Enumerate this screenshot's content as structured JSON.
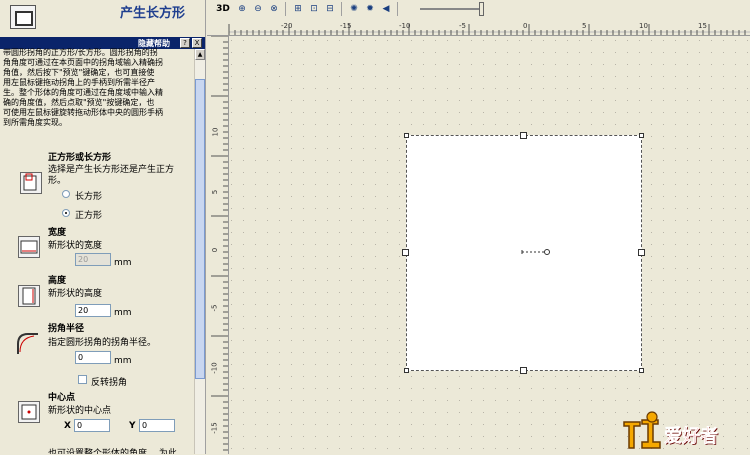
{
  "panel": {
    "title": "产生长方形",
    "help_label": "隐藏帮助",
    "help_btn_q": "?",
    "help_btn_x": "X",
    "help_text_lines": [
      "带圆形拐角的正方形/长方形。圆形拐角的拐",
      "角角度可通过在本页面中的拐角域输入精确拐",
      "角值，然后按下\"预览\"键确定，也可直接使",
      "用左鼠标键拖动拐角上的手柄到所需半径产",
      "生。整个形体的角度可通过在角度域中输入精",
      "确的角度值，然后点取\"预览\"按键确定，也",
      "可使用左鼠标键旋转拖动形体中央的圆形手柄",
      "到所需角度实现。"
    ],
    "shape_type": {
      "title": "正方形或长方形",
      "desc_line1": "选择是产生长方形还是产生正方",
      "desc_line2": "形。",
      "opt_rect": "长方形",
      "opt_square": "正方形",
      "selected": "正方形"
    },
    "width": {
      "title": "宽度",
      "desc": "新形状的宽度",
      "value": "20",
      "unit": "mm"
    },
    "height": {
      "title": "高度",
      "desc": "新形状的高度",
      "value": "20",
      "unit": "mm"
    },
    "radius": {
      "title": "拐角半径",
      "desc": "指定圆形拐角的拐角半径。",
      "value": "0",
      "unit": "mm",
      "reverse_label": "反转拐角"
    },
    "center": {
      "title": "中心点",
      "desc": "新形状的中心点",
      "x_label": "X",
      "x_value": "0",
      "y_label": "Y",
      "y_value": "0"
    },
    "bottom_text": "也可设置整个形体的角度。 为此"
  },
  "toolbar": {
    "label_3d": "3D"
  },
  "ruler": {
    "top_ticks": [
      {
        "label": "-20"
      },
      {
        "label": "-15"
      },
      {
        "label": "-10"
      },
      {
        "label": "-5"
      },
      {
        "label": "0"
      },
      {
        "label": "5"
      },
      {
        "label": "10"
      },
      {
        "label": "15"
      },
      {
        "label": "20"
      }
    ],
    "left_ticks": [
      {
        "label": "15"
      },
      {
        "label": "10"
      },
      {
        "label": "5"
      },
      {
        "label": "0"
      },
      {
        "label": "-5"
      },
      {
        "label": "-10"
      },
      {
        "label": "-15"
      }
    ]
  },
  "watermark": {
    "text": "爱好者"
  },
  "colors": {
    "title": "#1f3f8f",
    "help_bar": "#0a246a",
    "accent": "#0a246a"
  }
}
